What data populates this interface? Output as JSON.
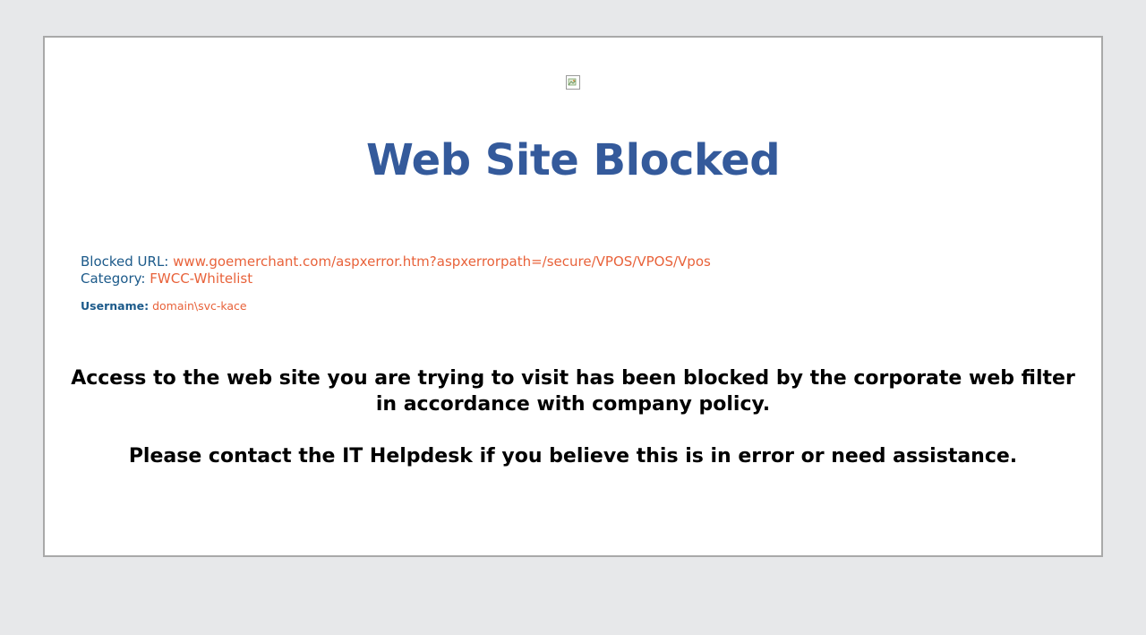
{
  "page": {
    "title": "Web Site Blocked"
  },
  "details": {
    "blocked_url_label": "Blocked URL:",
    "blocked_url_value": "www.goemerchant.com/aspxerror.htm?aspxerrorpath=/secure/VPOS/VPOS/Vpos",
    "category_label": "Category:",
    "category_value": "FWCC-Whitelist",
    "username_label": "Username:",
    "username_value": "domain\\svc-kace"
  },
  "message": {
    "line1": "Access to the web site you are trying to visit has been blocked by the corporate web filter in accordance with company policy.",
    "line2": "Please contact the IT Helpdesk if you believe this is in error or need assistance."
  },
  "icons": {
    "broken_image": "broken-image-icon"
  },
  "colors": {
    "title": "#345a9b",
    "label": "#1c5a8a",
    "value": "#e8623a",
    "background": "#e7e8ea",
    "panel_border": "#a9a9a9"
  }
}
